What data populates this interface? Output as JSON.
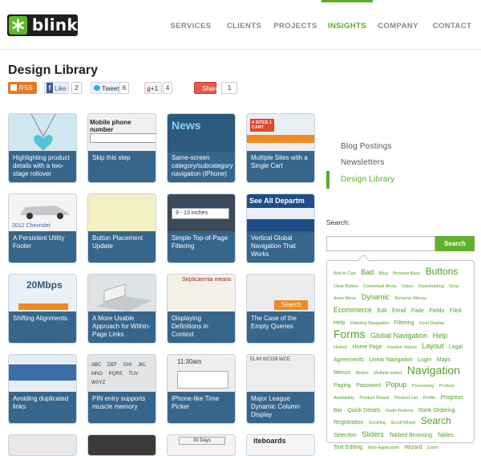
{
  "brand": {
    "name": "blink"
  },
  "nav": {
    "items": [
      {
        "label": "SERVICES",
        "active": false
      },
      {
        "label": "CLIENTS",
        "active": false
      },
      {
        "label": "PROJECTS",
        "active": false
      },
      {
        "label": "INSIGHTS",
        "active": true
      },
      {
        "label": "COMPANY",
        "active": false
      },
      {
        "label": "CONTACT",
        "active": false
      }
    ]
  },
  "page": {
    "title": "Design Library"
  },
  "share": {
    "rss": "RSS",
    "facebook_like": "Like",
    "facebook_count": "2",
    "tweet": "Tweet",
    "tweet_count": "6",
    "gplus": "+1",
    "gplus_count": "4",
    "share": "Share",
    "share_count": "1"
  },
  "tiles": [
    {
      "caption": "Highlighting product details with a two-stage rollover",
      "thumb": "pendant",
      "thumb_color": "#cfe7ef"
    },
    {
      "caption": "Skip this step",
      "thumb": "Mobile phone number",
      "thumb_color": "#e9ecef"
    },
    {
      "caption": "Same-screen category/subcategory navigation (iPhone)",
      "thumb": "News",
      "thumb_color": "#2c5a7e"
    },
    {
      "caption": "Multiple Sites with a Single Cart",
      "thumb": "4 SITES 1 CART",
      "thumb_color": "#e8eef4"
    },
    {
      "caption": "A Persistent Utility Footer",
      "thumb": "2012 Chevrolet",
      "thumb_color": "#f2f2f2"
    },
    {
      "caption": "Button Placement Update",
      "thumb": "",
      "thumb_color": "#f3f1c4"
    },
    {
      "caption": "Simple Top-of-Page Filtering",
      "thumb": "9 - 13 inches",
      "thumb_color": "#3a4a5a"
    },
    {
      "caption": "Vertical Global Navigation That Works",
      "thumb": "See All Departm",
      "thumb_color": "#1f4d86"
    },
    {
      "caption": "Shifting Alignments",
      "thumb": "20Mbps",
      "thumb_color": "#e9f1f6"
    },
    {
      "caption": "A More Usable Approach for Within-Page Links",
      "thumb": "",
      "thumb_color": "#dfe3e6"
    },
    {
      "caption": "Displaying Definitions in Context",
      "thumb": "Septicaemia means",
      "thumb_color": "#f4f0e8"
    },
    {
      "caption": "The Case of the Empty Queries",
      "thumb": "Search",
      "thumb_color": "#ececec"
    },
    {
      "caption": "Avoiding duplicated links",
      "thumb": "",
      "thumb_color": "#e5edf3"
    },
    {
      "caption": "PIN entry supports muscle memory",
      "thumb": "ABC DEF GHI JKL MNO PQRS TUV WXYZ",
      "thumb_color": "#e2e4e6"
    },
    {
      "caption": "iPhone-like Time Picker",
      "thumb": "11:30am",
      "thumb_color": "#eeeeee"
    },
    {
      "caption": "Major League Dynamic Column Display",
      "thumb": "ELIM WCGB WCE",
      "thumb_color": "#ededed"
    },
    {
      "caption": "",
      "thumb": "",
      "thumb_color": "#e8e8e8"
    },
    {
      "caption": "",
      "thumb": "",
      "thumb_color": "#3b3b3b"
    },
    {
      "caption": "",
      "thumb": "30 Days",
      "thumb_color": "#f3f3f3"
    },
    {
      "caption": "",
      "thumb": "iteboards",
      "thumb_color": "#f5f5f5"
    }
  ],
  "sidebar": {
    "links": [
      {
        "label": "Blog Postings",
        "active": false
      },
      {
        "label": "Newsletters",
        "active": false
      },
      {
        "label": "Design Library",
        "active": true
      }
    ],
    "search_label": "Search:",
    "search_placeholder": "",
    "search_button": "Search"
  },
  "tag_cloud": [
    {
      "label": "Add to Cart",
      "size": 1
    },
    {
      "label": "Bad",
      "size": 3
    },
    {
      "label": "Blog",
      "size": 1
    },
    {
      "label": "Browser Back",
      "size": 1
    },
    {
      "label": "Buttons",
      "size": 4
    },
    {
      "label": "Clear Button",
      "size": 1
    },
    {
      "label": "Contextual Menu",
      "size": 1
    },
    {
      "label": "Dates",
      "size": 1
    },
    {
      "label": "Downloading",
      "size": 1
    },
    {
      "label": "Drop-down Menu",
      "size": 1
    },
    {
      "label": "Dynamic",
      "size": 3
    },
    {
      "label": "Dynamic Menus",
      "size": 1
    },
    {
      "label": "Ecommerce",
      "size": 3
    },
    {
      "label": "Edit",
      "size": 2
    },
    {
      "label": "Email",
      "size": 2
    },
    {
      "label": "Fade",
      "size": 2
    },
    {
      "label": "Fields",
      "size": 2
    },
    {
      "label": "Filed",
      "size": 2
    },
    {
      "label": "Help",
      "size": 2
    },
    {
      "label": "Filmstrip Navigation",
      "size": 1
    },
    {
      "label": "Filtering",
      "size": 2
    },
    {
      "label": "Fluid Display",
      "size": 1
    },
    {
      "label": "Forms",
      "size": 5
    },
    {
      "label": "Global Navigation",
      "size": 3
    },
    {
      "label": "Help",
      "size": 3
    },
    {
      "label": "History",
      "size": 1
    },
    {
      "label": "Home Page",
      "size": 2
    },
    {
      "label": "Inactive Values",
      "size": 1
    },
    {
      "label": "Layout",
      "size": 3
    },
    {
      "label": "Legal Agreements",
      "size": 2
    },
    {
      "label": "Linear Navigation",
      "size": 2
    },
    {
      "label": "Login",
      "size": 2
    },
    {
      "label": "Maps",
      "size": 2
    },
    {
      "label": "Menus",
      "size": 2
    },
    {
      "label": "Mobile",
      "size": 1
    },
    {
      "label": "Multiple-select",
      "size": 1
    },
    {
      "label": "Navigation",
      "size": 5
    },
    {
      "label": "Paging",
      "size": 2
    },
    {
      "label": "Password",
      "size": 2
    },
    {
      "label": "Popup",
      "size": 3
    },
    {
      "label": "Processing",
      "size": 1
    },
    {
      "label": "Product Availability",
      "size": 1
    },
    {
      "label": "Product Details",
      "size": 1
    },
    {
      "label": "Product List",
      "size": 1
    },
    {
      "label": "Profile",
      "size": 1
    },
    {
      "label": "Progress Bar",
      "size": 2
    },
    {
      "label": "Quick Details",
      "size": 2
    },
    {
      "label": "Radio Buttons",
      "size": 1
    },
    {
      "label": "Rank Ordering",
      "size": 2
    },
    {
      "label": "Registration",
      "size": 2
    },
    {
      "label": "Scrolling",
      "size": 1
    },
    {
      "label": "Scroll Wheel",
      "size": 1
    },
    {
      "label": "Search",
      "size": 4
    },
    {
      "label": "Selection",
      "size": 2
    },
    {
      "label": "Sliders",
      "size": 3
    },
    {
      "label": "Tabbed Browsing",
      "size": 2
    },
    {
      "label": "Tables",
      "size": 2
    },
    {
      "label": "Text Editing",
      "size": 2
    },
    {
      "label": "Web Application",
      "size": 1
    },
    {
      "label": "Wizard",
      "size": 2
    },
    {
      "label": "Zoom",
      "size": 1
    }
  ],
  "colors": {
    "accent": "#5aab27",
    "caption_bg": "#2f5f86",
    "rss": "#e37a25",
    "facebook": "#3b5998",
    "twitter": "#2ba9e1",
    "share": "#e45b49"
  }
}
